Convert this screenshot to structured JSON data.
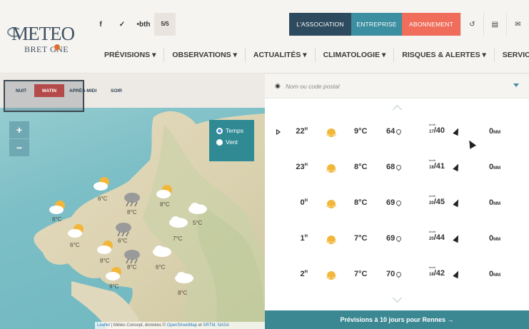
{
  "logo": {
    "main": "METEO",
    "sub": "BRET GNE"
  },
  "social": {
    "facebook": "f",
    "twitter": "✉",
    "stats": "•bth",
    "rating": "5/5"
  },
  "top_nav": [
    {
      "label": "L'ASSOCIATION",
      "color": "#2d4a5e"
    },
    {
      "label": "ENTREPRISE",
      "color": "#3b8fa0"
    },
    {
      "label": "ABONNEMENT",
      "color": "#ef6d5a"
    }
  ],
  "top_icons": [
    "login-icon",
    "cart-icon",
    "mail-icon"
  ],
  "main_nav": [
    "PRÉVISIONS",
    "OBSERVATIONS",
    "ACTUALITÉS",
    "CLIMATOLOGIE",
    "RISQUES & ALERTES",
    "SERVICES"
  ],
  "time_tabs": [
    "NUIT",
    "MATIN",
    "APRÈS-MIDI",
    "SOIR"
  ],
  "time_active": "MATIN",
  "map": {
    "zoom_in": "+",
    "zoom_out": "−",
    "layers": [
      "Temps",
      "Vent"
    ],
    "layer_selected": "Temps",
    "attribution_prefix": "Leaflet",
    "attribution_text": " | Météo Concept, données © ",
    "attribution_link1": "OpenStreetMap",
    "attribution_mid": " et ",
    "attribution_link2": "SRTM, NASA",
    "labels": [
      "6°C",
      "8°C",
      "8°C",
      "8°C",
      "5°C",
      "7°C",
      "6°C",
      "6°C",
      "8°C",
      "8°C",
      "6°C",
      "9°C",
      "8°C"
    ]
  },
  "search": {
    "placeholder": "Nom ou code postal"
  },
  "forecast": [
    {
      "hour": "22",
      "temp": "9°C",
      "humidity": "64",
      "wind_gust": "17",
      "wind": "/40",
      "rain": "0"
    },
    {
      "hour": "23",
      "temp": "8°C",
      "humidity": "68",
      "wind_gust": "18",
      "wind": "/41",
      "rain": "0"
    },
    {
      "hour": "0",
      "temp": "8°C",
      "humidity": "69",
      "wind_gust": "20",
      "wind": "/45",
      "rain": "0"
    },
    {
      "hour": "1",
      "temp": "7°C",
      "humidity": "69",
      "wind_gust": "20",
      "wind": "/44",
      "rain": "0"
    },
    {
      "hour": "2",
      "temp": "7°C",
      "humidity": "70",
      "wind_gust": "18",
      "wind": "/42",
      "rain": "0"
    }
  ],
  "units": {
    "hour": "H",
    "rain": "MM",
    "wind_label": "km/h"
  },
  "footer": "Prévisions à 10 jours pour Rennes →"
}
